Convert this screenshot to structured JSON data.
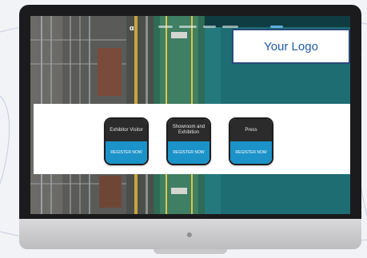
{
  "logo": {
    "text": "Your Logo"
  },
  "nav": {
    "brand_mark": "α"
  },
  "cards": [
    {
      "title": "Exhibitor Visitor",
      "button": "REGISTER NOW"
    },
    {
      "title": "Showroom and Exhibition",
      "button": "REGISTER NOW"
    },
    {
      "title": "Press",
      "button": "REGISTER NOW"
    }
  ],
  "colors": {
    "accent": "#1b93c9",
    "card_dark": "#2b2b2b",
    "logo_text": "#1e5aa8",
    "logo_border": "#2b4a7a"
  },
  "icons": {
    "chin_logo": "apple-icon"
  }
}
